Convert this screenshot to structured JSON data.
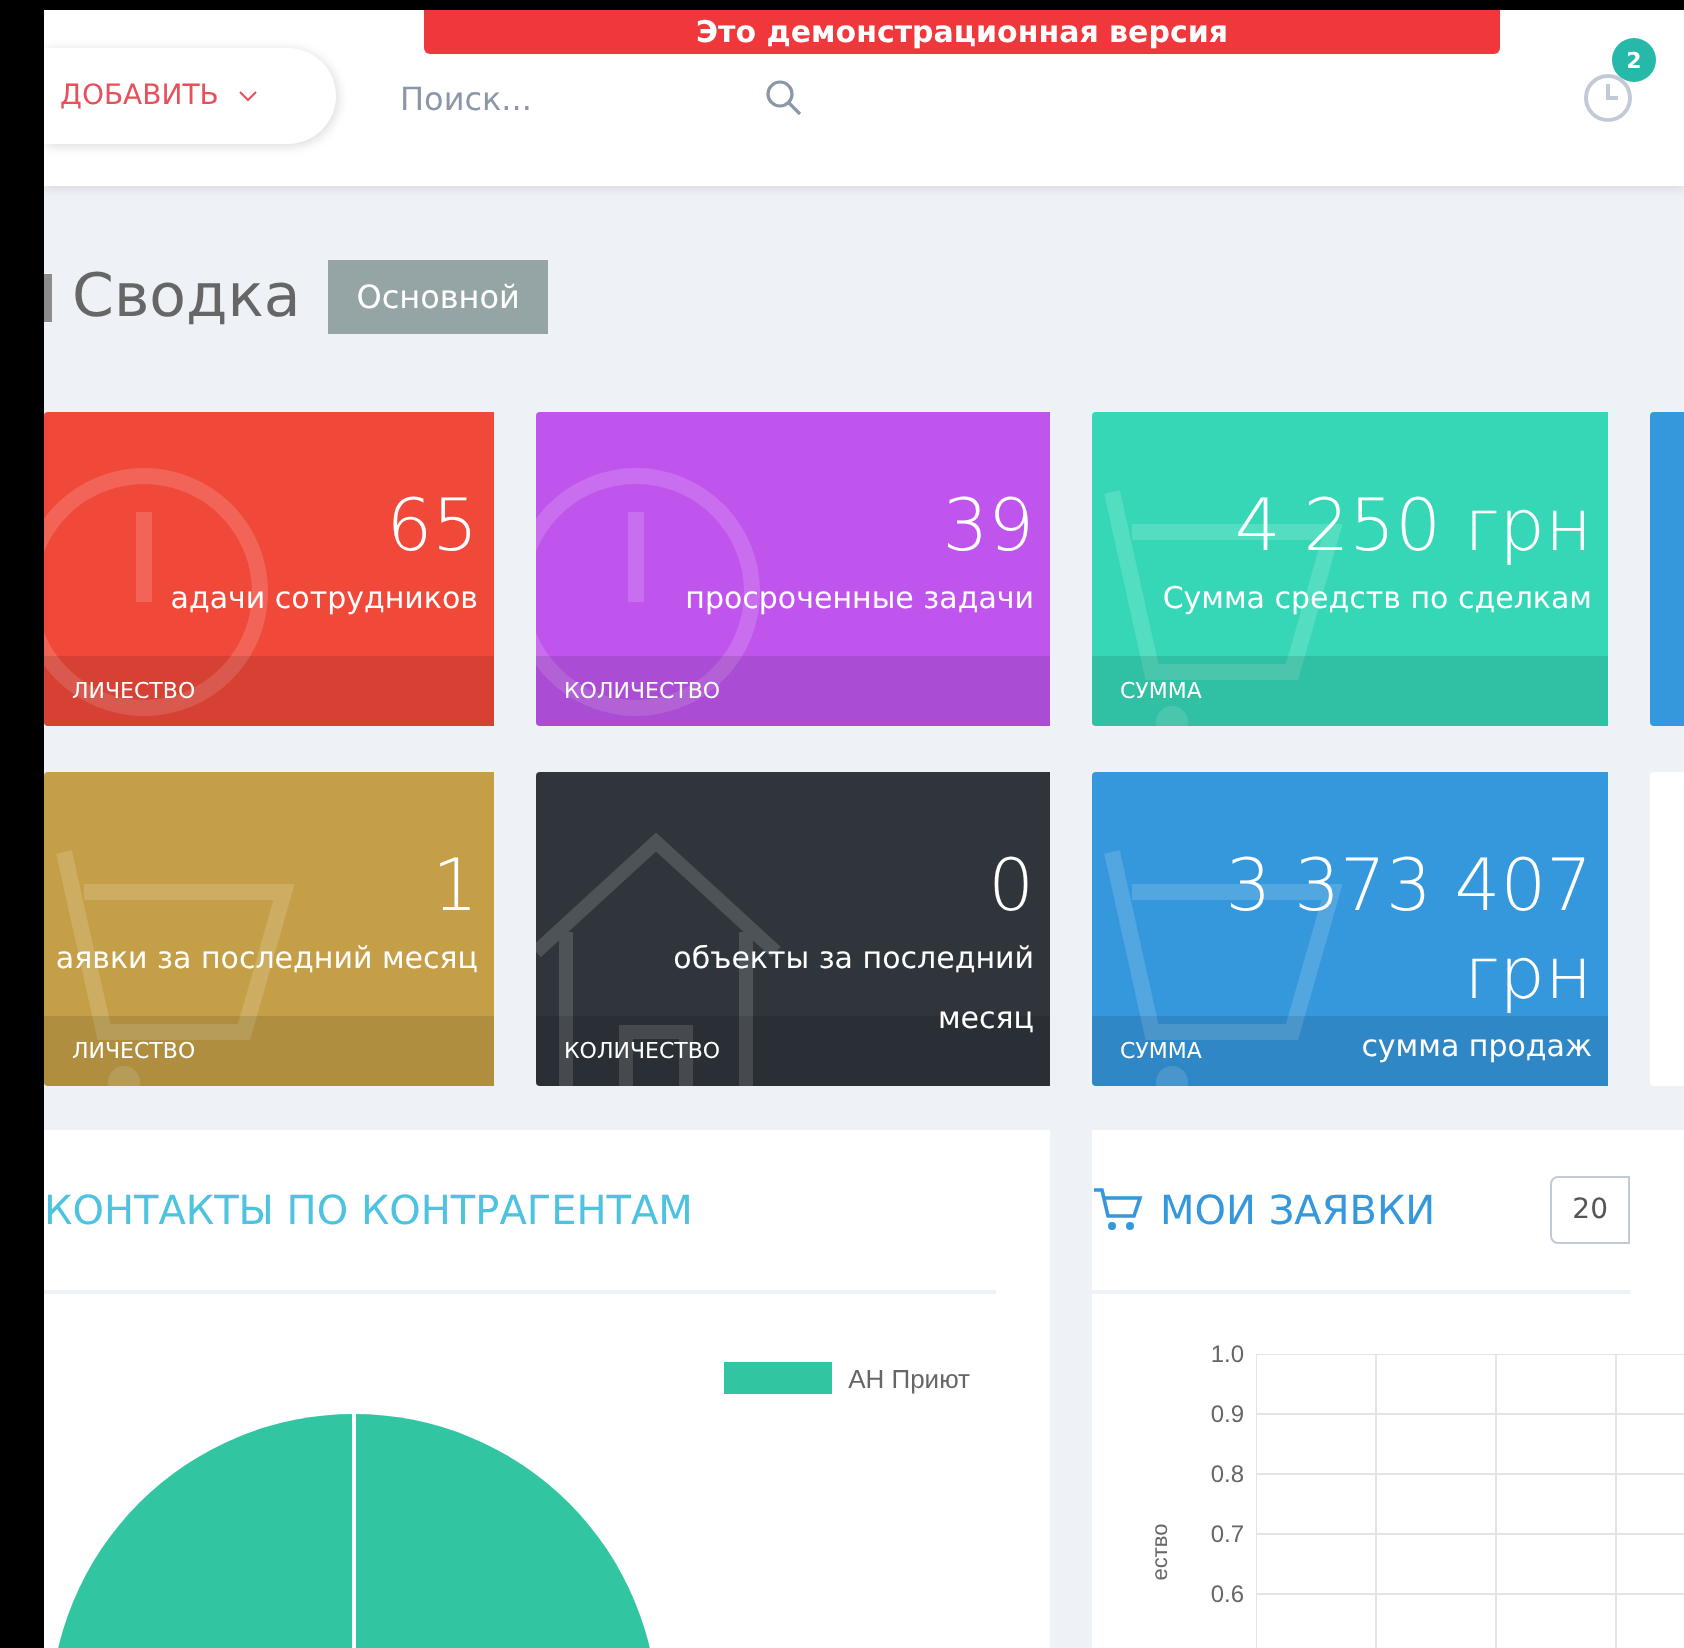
{
  "demo_banner": "Это демонстрационная версия",
  "header": {
    "add_button": "ДОБАВИТЬ",
    "search": {
      "placeholder": "Поиск..."
    },
    "notifications_count": "2"
  },
  "page": {
    "title": "Сводка",
    "badge": "Основной"
  },
  "cards": [
    {
      "kind": "clock",
      "value": "65",
      "label": "адачи сотрудников",
      "footer": "ЛИЧЕСТВО",
      "color": "#f0493a"
    },
    {
      "kind": "clock",
      "value": "39",
      "label": "просроченные задачи",
      "footer": "КОЛИЧЕСТВО",
      "color": "#bf55ec"
    },
    {
      "kind": "basket",
      "value": "4 250 грн",
      "label": "Сумма средств по сделкам",
      "footer": "СУММА",
      "color": "#36d7b7"
    },
    {
      "kind": "blank",
      "color": "#3598dc"
    },
    {
      "kind": "basket",
      "value": "1",
      "label": "аявки за последний месяц",
      "footer": "ЛИЧЕСТВО",
      "color": "#c49f47"
    },
    {
      "kind": "house",
      "value": "0",
      "label": "объекты за последний месяц",
      "footer": "КОЛИЧЕСТВО",
      "color": "#2f353b"
    },
    {
      "kind": "basket",
      "value": "3 373 407 грн",
      "label": "сумма продаж",
      "footer": "СУММА",
      "color": "#3598dc"
    },
    {
      "kind": "blank",
      "color": "#ffffff"
    }
  ],
  "contacts_panel": {
    "title": "КОНТАКТЫ ПО КОНТРАГЕНТАМ",
    "legend": [
      {
        "label": "АН Приют",
        "color": "#32c5a2"
      }
    ]
  },
  "orders_panel": {
    "title": "МОИ ЗАЯВКИ",
    "year_select": "20",
    "y_axis_label": "ество",
    "y_ticks": [
      "1.0",
      "0.9",
      "0.8",
      "0.7",
      "0.6"
    ]
  }
}
